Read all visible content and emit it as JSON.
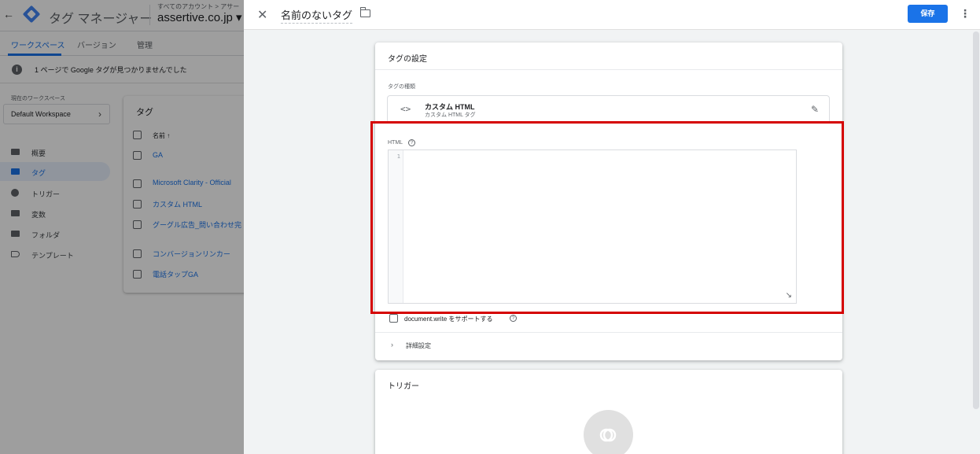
{
  "app": {
    "title": "タグ マネージャー",
    "account_breadcrumb": "すべてのアカウント > アサー",
    "account_name": "assertive.co.jp ▾"
  },
  "tabs": [
    {
      "label": "ワークスペース"
    },
    {
      "label": "バージョン"
    },
    {
      "label": "管理"
    }
  ],
  "notice": {
    "text": "1 ページで Google タグが見つかりませんでした"
  },
  "workspace": {
    "label": "現在のワークスペース",
    "name": "Default Workspace"
  },
  "sidebar": {
    "items": [
      {
        "label": "概要"
      },
      {
        "label": "タグ"
      },
      {
        "label": "トリガー"
      },
      {
        "label": "変数"
      },
      {
        "label": "フォルダ"
      },
      {
        "label": "テンプレート"
      }
    ]
  },
  "tags_card": {
    "title": "タグ",
    "column_header": "名前 ↑",
    "rows": [
      {
        "name": "GA"
      },
      {
        "name": "Microsoft Clarity - Official"
      },
      {
        "name": "カスタム HTML"
      },
      {
        "name": "グーグル広告_問い合わせ完"
      },
      {
        "name": "コンバージョンリンカー"
      },
      {
        "name": "電話タップGA"
      }
    ]
  },
  "panel": {
    "tag_name": "名前のないタグ",
    "save_label": "保存",
    "config": {
      "title": "タグの設定",
      "type_label": "タグの種類",
      "type_name": "カスタム HTML",
      "type_sub": "カスタム HTML タグ",
      "html_label": "HTML",
      "line_number": "1",
      "docwrite_label": "document.write をサポートする",
      "advanced_label": "詳細設定"
    },
    "trigger": {
      "title": "トリガー"
    }
  },
  "colors": {
    "accent": "#1a73e8",
    "highlight": "#d50000"
  }
}
